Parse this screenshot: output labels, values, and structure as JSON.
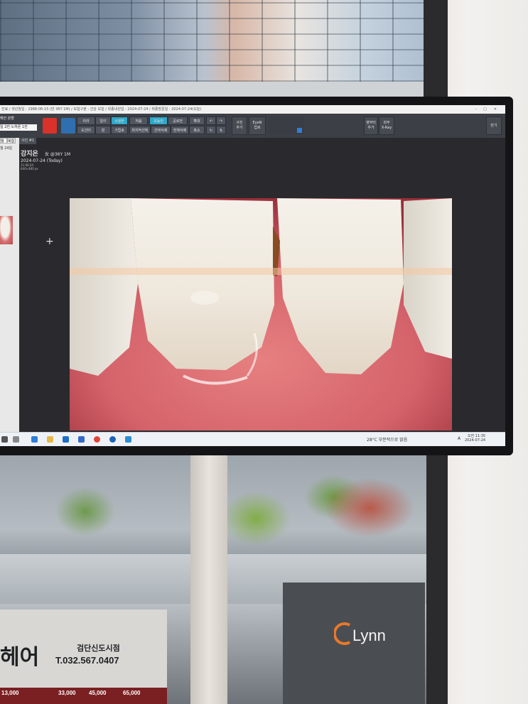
{
  "app": {
    "title_bar_text": "진료 / 생년월일 : 1988-06-15 (만 36Y 1M) / 보험구분 : 건강 보험 / 최종내원일 : 2024-07-24 / 최종방문일 : 2024-07-24(오늘)"
  },
  "toolbar": {
    "left_labels": [
      "해한 분할",
      "일 2컨 노하온 1컨"
    ],
    "buttons_row1": [
      "리라",
      "일이",
      "소밀한",
      "처음",
      "보동전",
      "공로전",
      "확대"
    ],
    "buttons_row2": [
      "도인터",
      "원",
      "기립로",
      "마지막선택",
      "선택삭제",
      "전체삭제",
      "축소"
    ],
    "big_buttons": [
      "사진\n추가",
      "EyeN\n업로",
      "영부터\n추가",
      "외부\nX-Ray",
      "닫기"
    ]
  },
  "left_panel": {
    "tab_labels": [
      "월",
      "복합"
    ],
    "tab_b": "사진 #1",
    "date_label": "월 24일"
  },
  "patient": {
    "name": "강지은",
    "sex_age": "女 @36Y 1M",
    "date": "2024-07-24 (Today)",
    "time": "11:00:24",
    "resolution": "640×480 px"
  },
  "taskbar": {
    "weather": "28°C 부분적으로 맑음",
    "time": "오전 11:35",
    "date": "2024-07-24",
    "lang": "A"
  },
  "signs": {
    "left_big": "헤어",
    "left_name": "검단신도시점",
    "left_phone": "T.032.567.0407",
    "brand": "Lynn",
    "prices": [
      "13,000",
      "33,000",
      "45,000",
      "65,000"
    ]
  },
  "colors": {
    "gum": "#d4626a",
    "tooth": "#f1ede4",
    "brand_orange": "#e8792c"
  }
}
